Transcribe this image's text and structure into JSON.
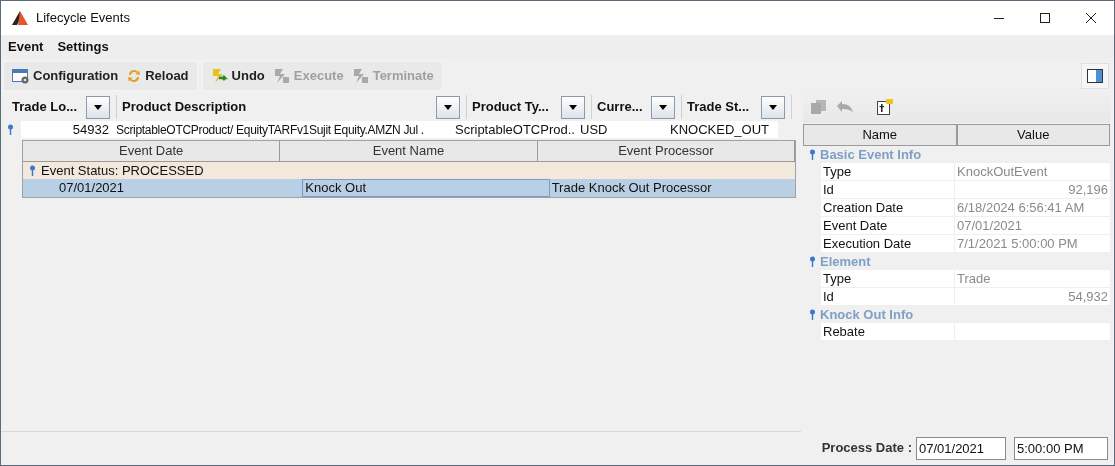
{
  "window": {
    "title": "Lifecycle Events"
  },
  "menu": [
    {
      "label": "Event"
    },
    {
      "label": "Settings"
    }
  ],
  "toolbar": [
    {
      "label": "Configuration",
      "kind": "config",
      "disabled": false
    },
    {
      "label": "Reload",
      "kind": "reload",
      "disabled": false
    },
    {
      "label": "Undo",
      "kind": "undo",
      "disabled": false,
      "separator_before": true
    },
    {
      "label": "Execute",
      "kind": "execute",
      "disabled": true
    },
    {
      "label": "Terminate",
      "kind": "terminate",
      "disabled": true
    }
  ],
  "trade_table": {
    "columns": [
      {
        "label": "Trade Lo..."
      },
      {
        "label": "Product Description"
      },
      {
        "label": "Product Ty..."
      },
      {
        "label": "Curre..."
      },
      {
        "label": "Trade St..."
      }
    ],
    "rows": [
      {
        "expanded": true,
        "cells": [
          "54932",
          "ScriptableOTCProduct/ EquityTARFv1Sujit Equity.AMZN Jul .",
          "ScriptableOTCProd..",
          "USD",
          "KNOCKED_OUT"
        ],
        "events": {
          "columns": [
            "Event Date",
            "Event Name",
            "Event Processor"
          ],
          "groups": [
            {
              "label": "Event Status: PROCESSED",
              "expanded": true,
              "rows": [
                {
                  "selected": true,
                  "cells": [
                    "07/01/2021",
                    "Knock Out",
                    "Trade Knock Out Processor"
                  ]
                }
              ]
            }
          ]
        }
      }
    ]
  },
  "properties": {
    "tools": [
      {
        "kind": "copy",
        "disabled": true
      },
      {
        "kind": "undo",
        "disabled": true
      },
      {
        "kind": "note",
        "disabled": false
      }
    ],
    "columns": [
      "Name",
      "Value"
    ],
    "sections": [
      {
        "title": "Basic Event Info",
        "expanded": true,
        "rows": [
          {
            "name": "Type",
            "value": "KnockOutEvent",
            "kind": "text"
          },
          {
            "name": "Id",
            "value": "92,196",
            "kind": "number"
          },
          {
            "name": "Creation Date",
            "value": "6/18/2024 6:56:41 AM",
            "kind": "text"
          },
          {
            "name": "Event Date",
            "value": "07/01/2021",
            "kind": "text"
          },
          {
            "name": "Execution Date",
            "value": "7/1/2021 5:00:00 PM",
            "kind": "text"
          }
        ]
      },
      {
        "title": "Element",
        "expanded": true,
        "rows": [
          {
            "name": "Type",
            "value": "Trade",
            "kind": "text"
          },
          {
            "name": "Id",
            "value": "54,932",
            "kind": "number"
          }
        ]
      },
      {
        "title": "Knock Out Info",
        "expanded": true,
        "rows": [
          {
            "name": "Rebate",
            "kind": "text"
          }
        ]
      }
    ]
  },
  "process_date": {
    "label": "Process Date :",
    "date": "07/01/2021",
    "time": "5:00:00 PM"
  }
}
